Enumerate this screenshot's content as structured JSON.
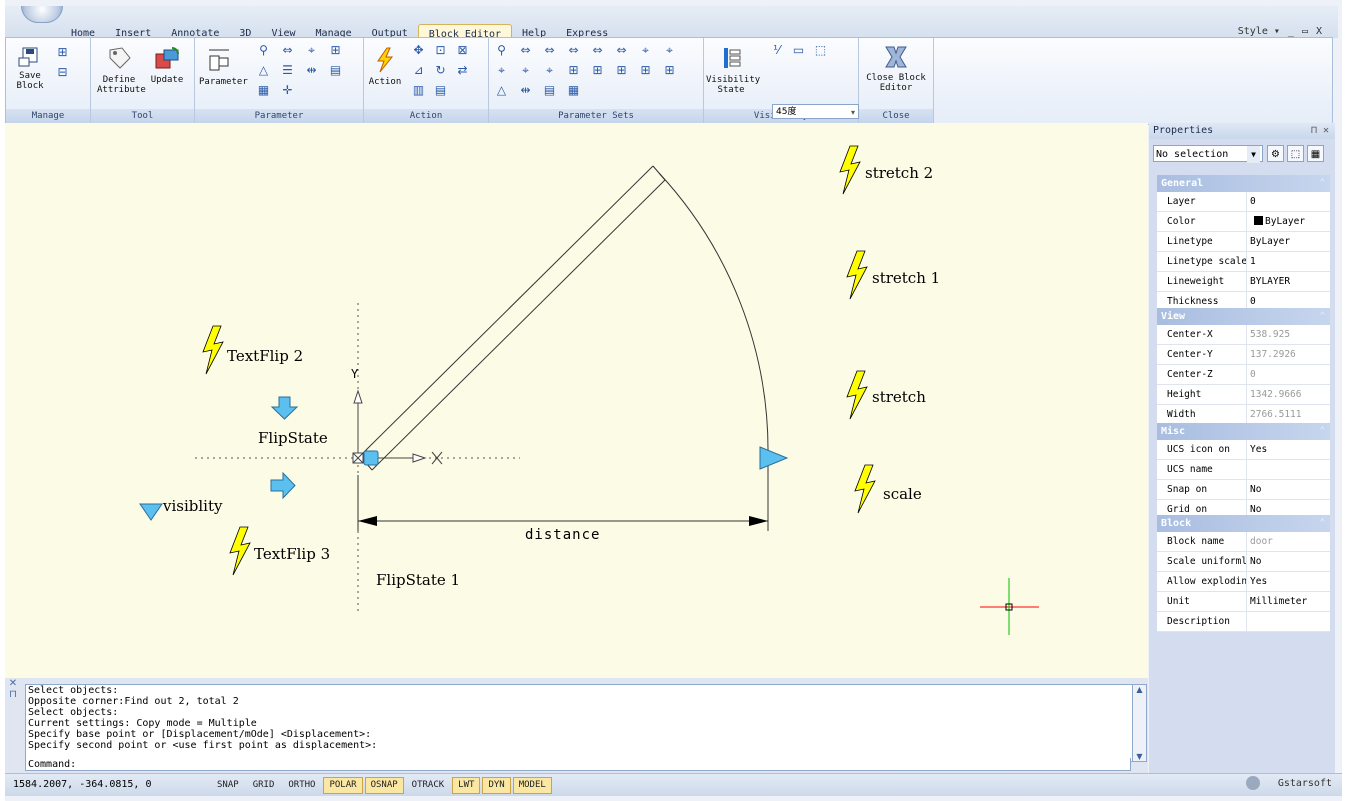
{
  "tabs": [
    {
      "label": "Home",
      "active": false
    },
    {
      "label": "Insert",
      "active": false
    },
    {
      "label": "Annotate",
      "active": false
    },
    {
      "label": "3D",
      "active": false
    },
    {
      "label": "View",
      "active": false
    },
    {
      "label": "Manage",
      "active": false
    },
    {
      "label": "Output",
      "active": false
    },
    {
      "label": "Block Editor",
      "active": true
    },
    {
      "label": "Help",
      "active": false
    },
    {
      "label": "Express",
      "active": false
    }
  ],
  "window_controls": {
    "style_label": "Style ▾",
    "minimize": "_",
    "restore": "▭",
    "close": "X"
  },
  "ribbon": {
    "panels": {
      "manage": "Manage",
      "tool": "Tool",
      "parameter": "Parameter",
      "action": "Action",
      "parameter_sets": "Parameter Sets",
      "visibility": "Visibility",
      "close": "Close"
    },
    "buttons": {
      "save_block": "Save\nBlock",
      "define_attribute": "Define\nAttribute",
      "update": "Update",
      "parameter": "Parameter",
      "action": "Action",
      "visibility_state": "Visibility\nState",
      "close_block_editor": "Close Block\nEditor"
    },
    "visibility_dropdown": "45度"
  },
  "canvas_labels": {
    "stretch2": "stretch 2",
    "stretch1": "stretch 1",
    "stretch": "stretch",
    "scale": "scale",
    "textflip2": "TextFlip  2",
    "textflip3": "TextFlip 3",
    "flipstate": "FlipState",
    "flipstate1": "FlipState 1",
    "visiblity": "visiblity",
    "distance": "distance",
    "y_axis": "Y",
    "x_axis": "X"
  },
  "properties": {
    "title": "Properties",
    "selection": "No selection",
    "sections": [
      {
        "title": "General",
        "rows": [
          {
            "k": "Layer",
            "v": "0"
          },
          {
            "k": "Color",
            "v": "ByLayer",
            "swatch": "#000000"
          },
          {
            "k": "Linetype",
            "v": "ByLayer"
          },
          {
            "k": "Linetype scale",
            "v": "1"
          },
          {
            "k": "Lineweight",
            "v": "BYLAYER"
          },
          {
            "k": "Thickness",
            "v": "0"
          }
        ]
      },
      {
        "title": "View",
        "rows": [
          {
            "k": "Center-X",
            "v": "538.925",
            "gray": true
          },
          {
            "k": "Center-Y",
            "v": "137.2926",
            "gray": true
          },
          {
            "k": "Center-Z",
            "v": "0",
            "gray": true
          },
          {
            "k": "Height",
            "v": "1342.9666",
            "gray": true
          },
          {
            "k": "Width",
            "v": "2766.5111",
            "gray": true
          }
        ]
      },
      {
        "title": "Misc",
        "rows": [
          {
            "k": "UCS icon on",
            "v": "Yes"
          },
          {
            "k": "UCS name",
            "v": ""
          },
          {
            "k": "Snap on",
            "v": "No"
          },
          {
            "k": "Grid on",
            "v": "No"
          }
        ]
      },
      {
        "title": "Block",
        "rows": [
          {
            "k": "Block name",
            "v": "door",
            "gray": true
          },
          {
            "k": "Scale uniformly",
            "v": "No"
          },
          {
            "k": "Allow exploding",
            "v": "Yes"
          },
          {
            "k": "Unit",
            "v": "Millimeter"
          },
          {
            "k": "Description",
            "v": ""
          }
        ]
      }
    ]
  },
  "command_history": [
    "Select objects:",
    "Opposite corner:Find out 2, total 2",
    "Select objects:",
    "Current settings: Copy mode = Multiple",
    "Specify base point or [Displacement/mOde] <Displacement>:",
    "Specify second point or <use first point as displacement>:"
  ],
  "command_prompt": "Command:",
  "status": {
    "coordinates": "1584.2007, -364.0815, 0",
    "toggles": [
      {
        "label": "SNAP",
        "on": false
      },
      {
        "label": "GRID",
        "on": false
      },
      {
        "label": "ORTHO",
        "on": false
      },
      {
        "label": "POLAR",
        "on": true
      },
      {
        "label": "OSNAP",
        "on": true
      },
      {
        "label": "OTRACK",
        "on": false
      },
      {
        "label": "LWT",
        "on": true
      },
      {
        "label": "DYN",
        "on": true
      },
      {
        "label": "MODEL",
        "on": true
      }
    ],
    "brand": "Gstarsoft"
  },
  "colors": {
    "canvas_bg": "#fcfbe6",
    "lightning": "#ffff00",
    "grip_blue": "#5bc0f0",
    "crosshair_red": "#ff0000",
    "crosshair_green": "#00c000"
  }
}
